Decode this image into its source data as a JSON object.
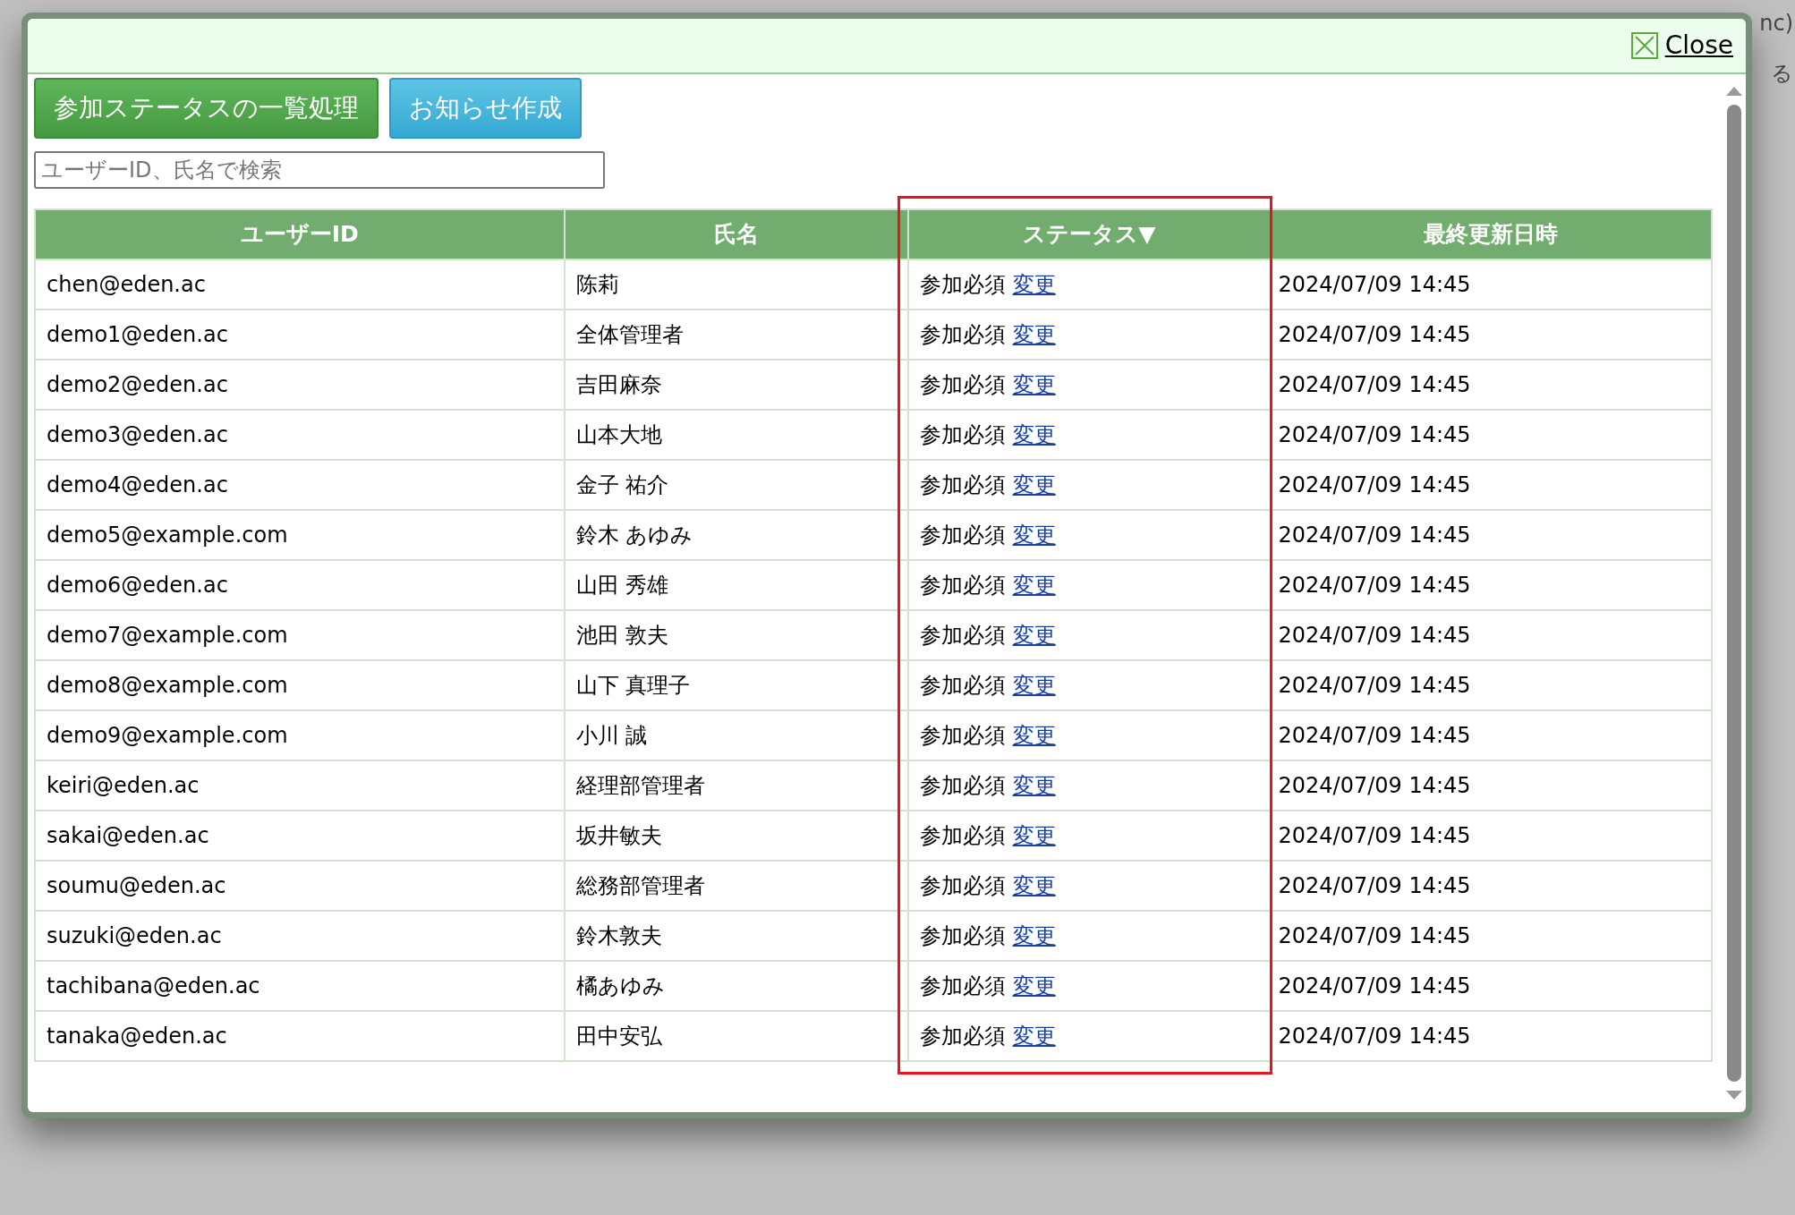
{
  "background_texts": [
    "nc)",
    "る"
  ],
  "dialog": {
    "close_label": "Close"
  },
  "buttons": [
    {
      "label": "参加ステータスの一覧処理",
      "kind": "primary"
    },
    {
      "label": "お知らせ作成",
      "kind": "info"
    }
  ],
  "search": {
    "placeholder": "ユーザーID、氏名で検索"
  },
  "table": {
    "columns": [
      {
        "label": "ユーザーID",
        "highlighted": false
      },
      {
        "label": "氏名",
        "highlighted": false
      },
      {
        "label": "ステータス▼",
        "highlighted": true
      },
      {
        "label": "最終更新日時",
        "highlighted": false
      }
    ],
    "rows": [
      {
        "user_id": "chen@eden.ac",
        "name": "陈莉",
        "status": "参加必須",
        "action": "変更",
        "updated": "2024/07/09 14:45"
      },
      {
        "user_id": "demo1@eden.ac",
        "name": "全体管理者",
        "status": "参加必須",
        "action": "変更",
        "updated": "2024/07/09 14:45"
      },
      {
        "user_id": "demo2@eden.ac",
        "name": "吉田麻奈",
        "status": "参加必須",
        "action": "変更",
        "updated": "2024/07/09 14:45"
      },
      {
        "user_id": "demo3@eden.ac",
        "name": "山本大地",
        "status": "参加必須",
        "action": "変更",
        "updated": "2024/07/09 14:45"
      },
      {
        "user_id": "demo4@eden.ac",
        "name": "金子 祐介",
        "status": "参加必須",
        "action": "変更",
        "updated": "2024/07/09 14:45"
      },
      {
        "user_id": "demo5@example.com",
        "name": "鈴木 あゆみ",
        "status": "参加必須",
        "action": "変更",
        "updated": "2024/07/09 14:45"
      },
      {
        "user_id": "demo6@eden.ac",
        "name": "山田 秀雄",
        "status": "参加必須",
        "action": "変更",
        "updated": "2024/07/09 14:45"
      },
      {
        "user_id": "demo7@example.com",
        "name": "池田 敦夫",
        "status": "参加必須",
        "action": "変更",
        "updated": "2024/07/09 14:45"
      },
      {
        "user_id": "demo8@example.com",
        "name": "山下 真理子",
        "status": "参加必須",
        "action": "変更",
        "updated": "2024/07/09 14:45"
      },
      {
        "user_id": "demo9@example.com",
        "name": "小川 誠",
        "status": "参加必須",
        "action": "変更",
        "updated": "2024/07/09 14:45"
      },
      {
        "user_id": "keiri@eden.ac",
        "name": "経理部管理者",
        "status": "参加必須",
        "action": "変更",
        "updated": "2024/07/09 14:45"
      },
      {
        "user_id": "sakai@eden.ac",
        "name": "坂井敏夫",
        "status": "参加必須",
        "action": "変更",
        "updated": "2024/07/09 14:45"
      },
      {
        "user_id": "soumu@eden.ac",
        "name": "総務部管理者",
        "status": "参加必須",
        "action": "変更",
        "updated": "2024/07/09 14:45"
      },
      {
        "user_id": "suzuki@eden.ac",
        "name": "鈴木敦夫",
        "status": "参加必須",
        "action": "変更",
        "updated": "2024/07/09 14:45"
      },
      {
        "user_id": "tachibana@eden.ac",
        "name": "橘あゆみ",
        "status": "参加必須",
        "action": "変更",
        "updated": "2024/07/09 14:45"
      },
      {
        "user_id": "tanaka@eden.ac",
        "name": "田中安弘",
        "status": "参加必須",
        "action": "変更",
        "updated": "2024/07/09 14:45"
      }
    ]
  }
}
